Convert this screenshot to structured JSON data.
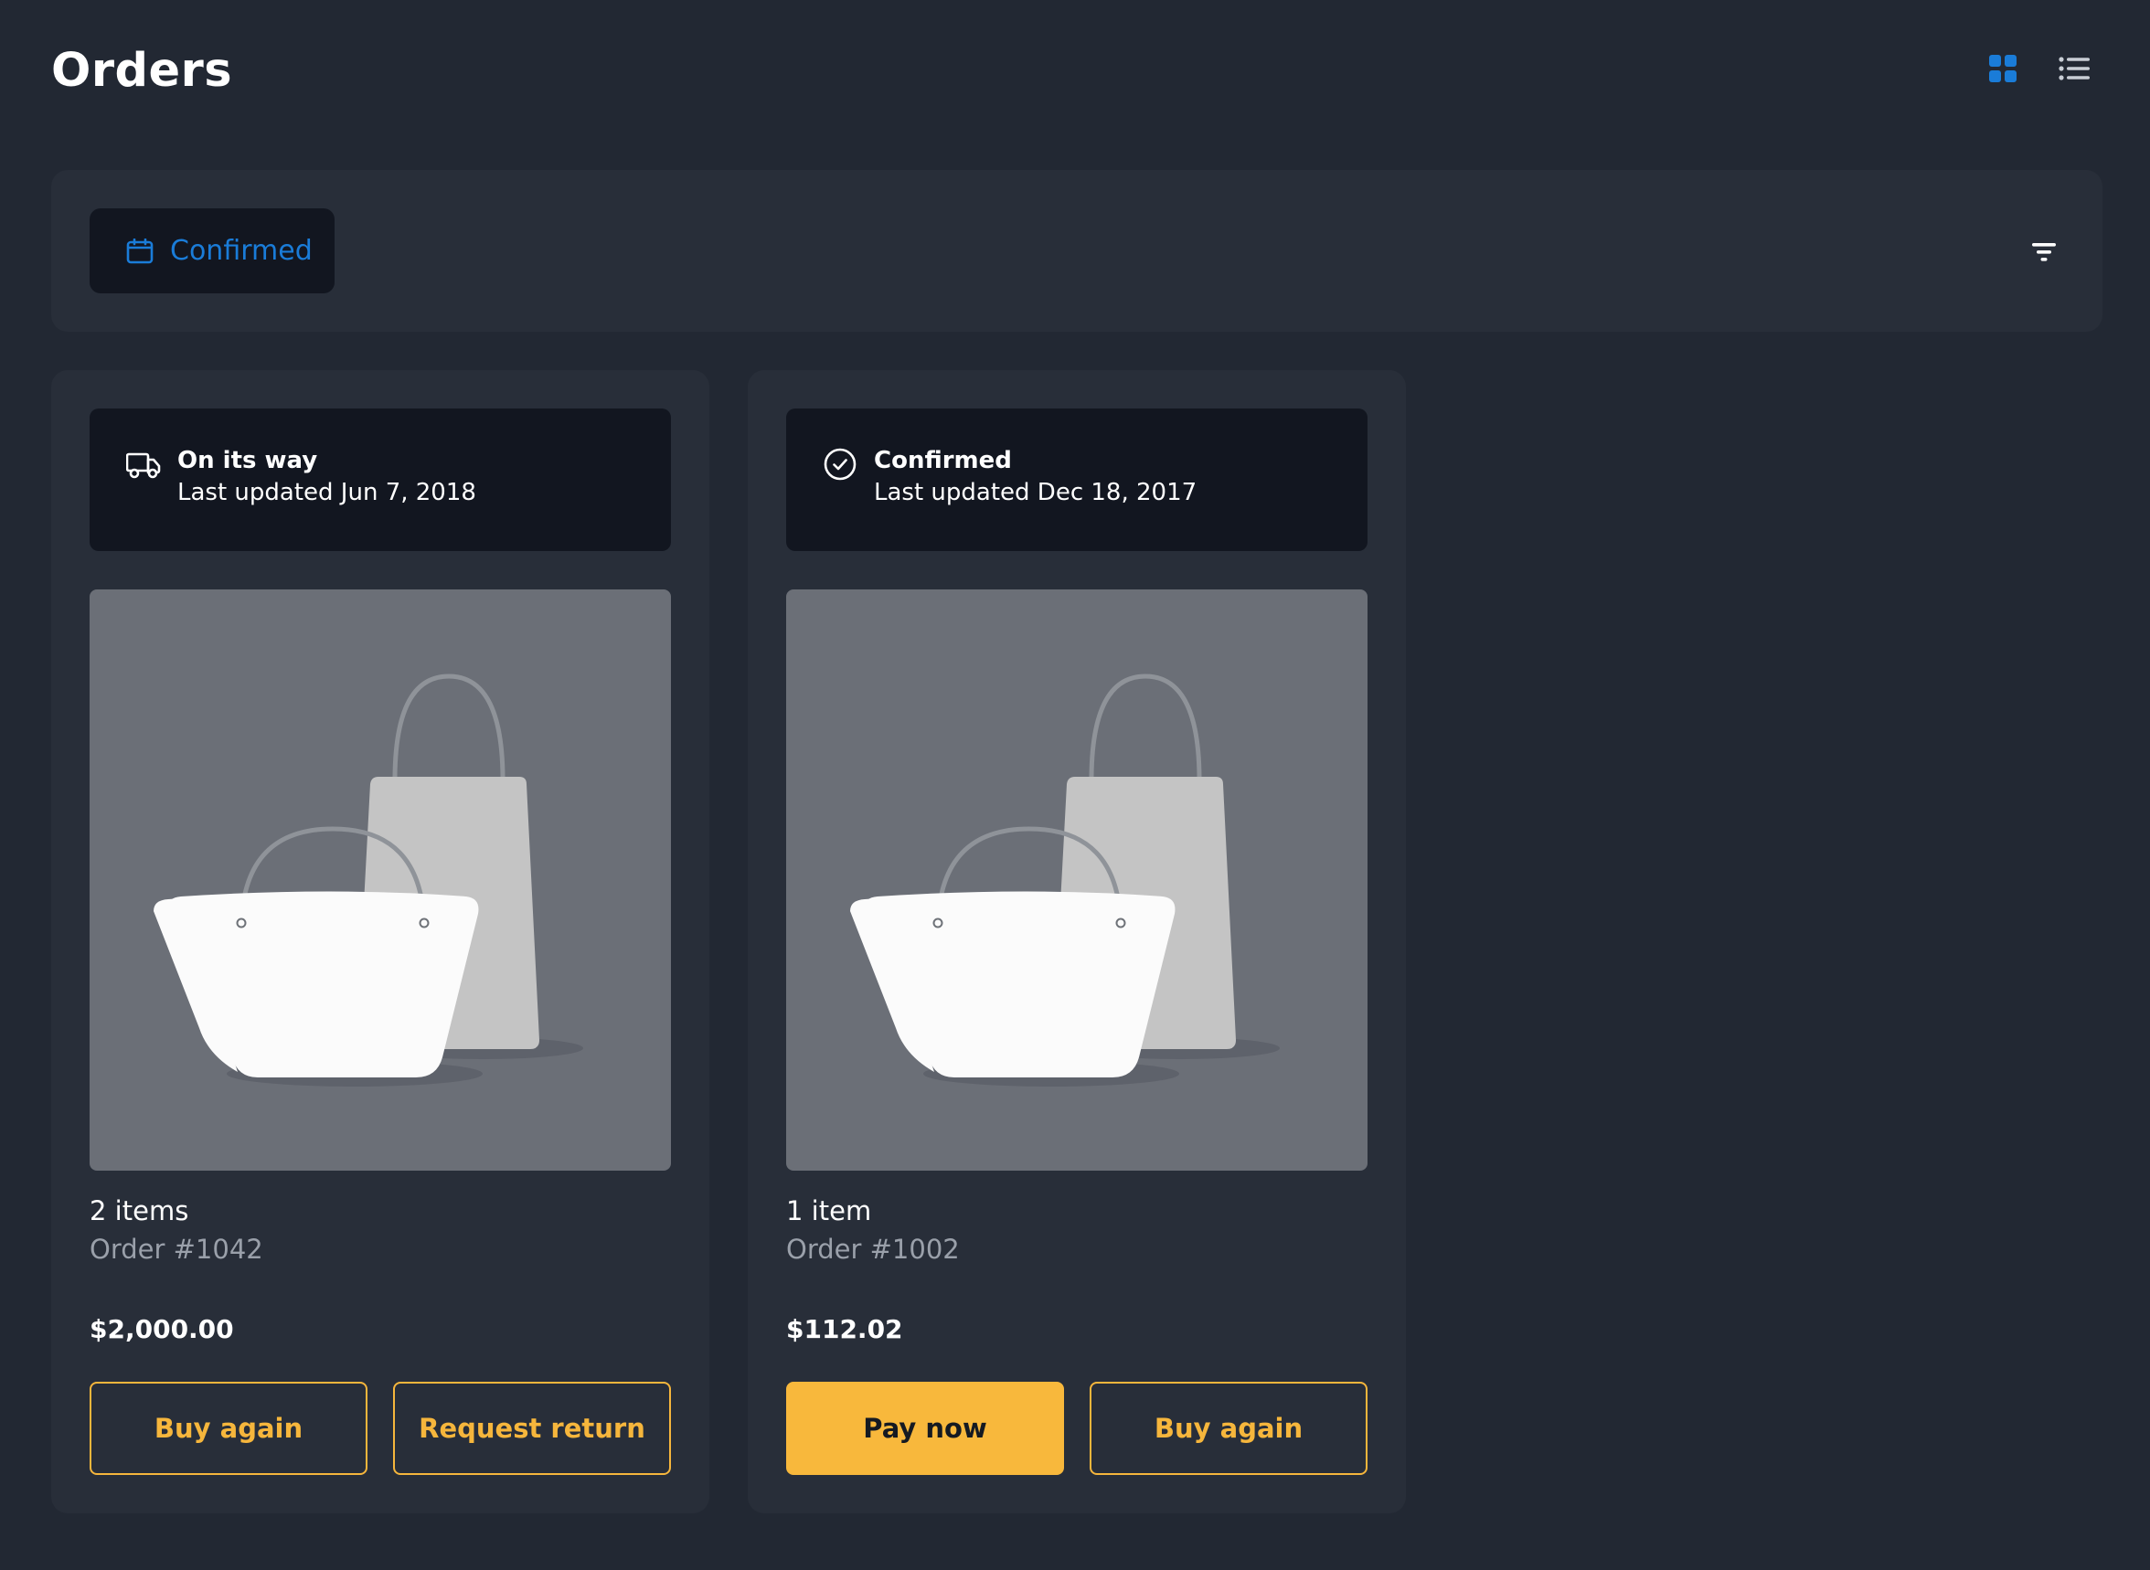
{
  "page": {
    "title": "Orders"
  },
  "view_toggle": {
    "grid_icon": "grid-view-icon",
    "list_icon": "list-view-icon",
    "active": "grid",
    "active_color": "#1a7cd8",
    "inactive_color": "#c9ced6"
  },
  "filter": {
    "chip_icon": "calendar-icon",
    "chip_label": "Confirmed",
    "filter_icon": "filter-icon"
  },
  "orders": [
    {
      "status_icon": "truck-icon",
      "status": "On its way",
      "updated": "Last updated Jun 7, 2018",
      "items": "2 items",
      "order_number": "Order #1042",
      "total": "$2,000.00",
      "actions": [
        {
          "label": "Buy again",
          "style": "outline"
        },
        {
          "label": "Request return",
          "style": "outline"
        }
      ]
    },
    {
      "status_icon": "check-circle-icon",
      "status": "Confirmed",
      "updated": "Last updated Dec 18, 2017",
      "items": "1 item",
      "order_number": "Order #1002",
      "total": "$112.02",
      "actions": [
        {
          "label": "Pay now",
          "style": "solid"
        },
        {
          "label": "Buy again",
          "style": "outline"
        }
      ]
    }
  ],
  "colors": {
    "background": "#222833",
    "surface": "#282e39",
    "panel": "#121620",
    "accent": "#f8b83c",
    "link": "#1a7cd8"
  }
}
